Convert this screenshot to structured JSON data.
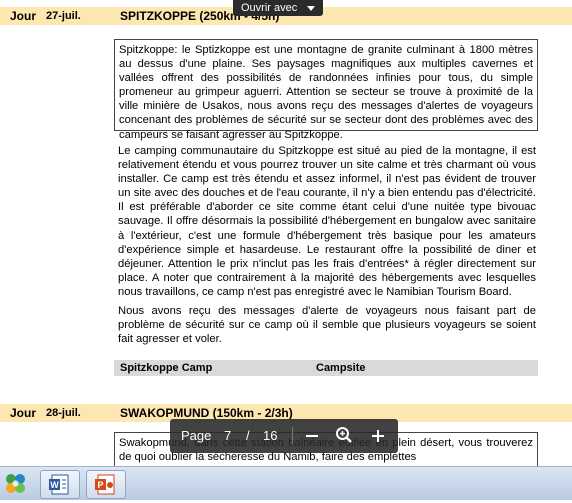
{
  "toolbar": {
    "open_with": "Ouvrir avec"
  },
  "day1": {
    "jour": "Jour",
    "date": "27-juil.",
    "title": "SPITZKOPPE (250km - 4/5h)",
    "box_text": "Spitzkoppe: le Sptizkoppe est une montagne de granite culminant à 1800 mètres au dessus d'une plaine. Ses paysages magnifiques aux multiples cavernes et vallées offrent des possibilités de randonnées infinies pour tous, du simple promeneur au grimpeur aguerri. Attention se secteur se trouve à proximité de la ville minière de Usakos, nous avons reçu des messages d'alertes de voyageurs concenant des problèmes de sécurité sur se secteur dont des problèmes avec des campeurs se faisant agresser au Spitzkoppe.",
    "para1": "Le camping communautaire du Spitzkoppe est situé au pied de la montagne, il est relativement étendu et vous pourrez trouver un site calme et très charmant où vous installer. Ce camp est très étendu et assez informel, il n'est pas évident de trouver un site avec des douches et de l'eau courante, il n'y a bien entendu pas d'électricité. Il est préférable d'aborder ce site comme étant celui d'une nuitée type bivouac sauvage. Il offre désormais la possibilité d'hébergement en bungalow avec sanitaire à l'extérieur, c'est une formule d'hébergement très basique pour les amateurs d'expérience simple et hasardeuse. Le restaurant offre la possibilité de diner et déjeuner. Attention le prix n'inclut pas les frais d'entrées* à régler directement sur place. A noter que contrairement à la majorité des hébergements avec lesquelles nous travaillons, ce camp n'est pas enregistré avec le Namibian Tourism Board.",
    "para2": "Nous avons reçu des messages d'alerte de voyageurs nous faisant part de problème de sécurité sur ce camp où il semble que plusieurs voyageurs se soient fait agresser et voler.",
    "camp_name": "Spitzkoppe Camp",
    "camp_type": "Campsite"
  },
  "day2": {
    "jour": "Jour",
    "date": "28-juil.",
    "title": "SWAKOPMUND (150km - 2/3h)",
    "box_text": "Swakopmund, dans cette station balnéaire édifiée en plein désert, vous trouverez de quoi oublier la sécheresse du Namib, faire des emplettes"
  },
  "pagebar": {
    "page_label": "Page",
    "current_page": "7",
    "slash": "/",
    "total_pages": "16"
  },
  "taskbar": {
    "icons": [
      "windows-live-icon",
      "word-icon",
      "powerpoint-icon"
    ]
  },
  "colors": {
    "day_band": "#fce7b0",
    "camp_row": "#d9d9d9",
    "toolbar": "#2b2b2b"
  }
}
